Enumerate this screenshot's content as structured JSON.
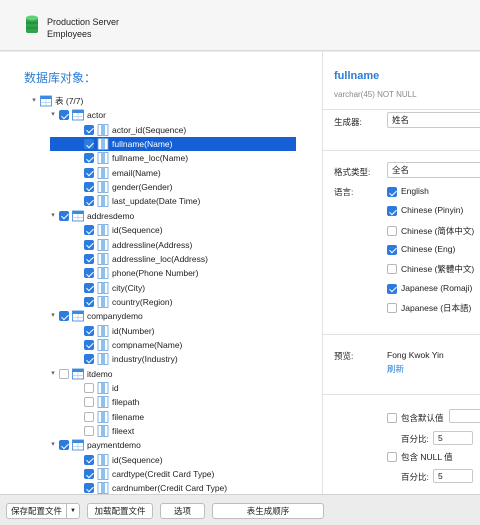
{
  "window": {
    "title": "Production Server",
    "subtitle": "Employees"
  },
  "left": {
    "title": "数据库对象：",
    "tree": [
      {
        "level": 0,
        "disc": "down",
        "cb": false,
        "icon": "tables",
        "label": "表 (7/7)"
      },
      {
        "level": 1,
        "disc": "down",
        "cb": true,
        "icon": "table",
        "label": "actor"
      },
      {
        "level": 2,
        "cb": true,
        "icon": "column",
        "label": "actor_id(Sequence)"
      },
      {
        "level": 2,
        "cb": true,
        "icon": "column",
        "label": "fullname(Name)",
        "selected": true
      },
      {
        "level": 2,
        "cb": true,
        "icon": "column",
        "label": "fullname_loc(Name)"
      },
      {
        "level": 2,
        "cb": true,
        "icon": "column",
        "label": "email(Name)"
      },
      {
        "level": 2,
        "cb": true,
        "icon": "column",
        "label": "gender(Gender)"
      },
      {
        "level": 2,
        "cb": true,
        "icon": "column",
        "label": "last_update(Date Time)"
      },
      {
        "level": 1,
        "disc": "down",
        "cb": true,
        "icon": "table",
        "label": "addresdemo"
      },
      {
        "level": 2,
        "cb": true,
        "icon": "column",
        "label": "id(Sequence)"
      },
      {
        "level": 2,
        "cb": true,
        "icon": "column",
        "label": "addressline(Address)"
      },
      {
        "level": 2,
        "cb": true,
        "icon": "column",
        "label": "addressline_loc(Address)"
      },
      {
        "level": 2,
        "cb": true,
        "icon": "column",
        "label": "phone(Phone Number)"
      },
      {
        "level": 2,
        "cb": true,
        "icon": "column",
        "label": "city(City)"
      },
      {
        "level": 2,
        "cb": true,
        "icon": "column",
        "label": "country(Region)"
      },
      {
        "level": 1,
        "disc": "down",
        "cb": true,
        "icon": "table",
        "label": "companydemo"
      },
      {
        "level": 2,
        "cb": true,
        "icon": "column",
        "label": "id(Number)"
      },
      {
        "level": 2,
        "cb": true,
        "icon": "column",
        "label": "compname(Name)"
      },
      {
        "level": 2,
        "cb": true,
        "icon": "column",
        "label": "industry(Industry)"
      },
      {
        "level": 1,
        "disc": "down",
        "cb": false,
        "icon": "table",
        "label": "itdemo"
      },
      {
        "level": 2,
        "cb": false,
        "icon": "column",
        "label": "id"
      },
      {
        "level": 2,
        "cb": false,
        "icon": "column",
        "label": "filepath"
      },
      {
        "level": 2,
        "cb": false,
        "icon": "column",
        "label": "filename"
      },
      {
        "level": 2,
        "cb": false,
        "icon": "column",
        "label": "fileext"
      },
      {
        "level": 1,
        "disc": "down",
        "cb": true,
        "icon": "table",
        "label": "paymentdemo"
      },
      {
        "level": 2,
        "cb": true,
        "icon": "column",
        "label": "id(Sequence)"
      },
      {
        "level": 2,
        "cb": true,
        "icon": "column",
        "label": "cardtype(Credit Card Type)"
      },
      {
        "level": 2,
        "cb": true,
        "icon": "column",
        "label": "cardnumber(Credit Card Type)"
      }
    ]
  },
  "right": {
    "field_name": "fullname",
    "field_type": "varchar(45) NOT NULL",
    "generator_label": "生成器:",
    "generator_value": "姓名",
    "format_label": "格式类型:",
    "format_value": "全名",
    "language_label": "语言:",
    "languages": [
      {
        "label": "English",
        "checked": true
      },
      {
        "label": "Chinese (Pinyin)",
        "checked": true
      },
      {
        "label": "Chinese (简体中文)",
        "checked": false
      },
      {
        "label": "Chinese (Eng)",
        "checked": true
      },
      {
        "label": "Chinese (繁體中文)",
        "checked": false
      },
      {
        "label": "Japanese (Romaji)",
        "checked": true
      },
      {
        "label": "Japanese (日本語)",
        "checked": false
      }
    ],
    "preview_label": "预览:",
    "preview_value": "Fong Kwok Yin",
    "refresh_label": "刷新",
    "include_default_label": "包含默认值",
    "percent_label": "百分比:",
    "percent_default": "5",
    "include_null_label": "包含 NULL 值",
    "percent_null": "5"
  },
  "bottom": {
    "save_config": "保存配置文件",
    "load_config": "加载配置文件",
    "options": "选项",
    "table_order": "表生成顺序"
  },
  "colors": {
    "accent": "#2a7fd4",
    "selection": "#1560d4",
    "checkbox": "#2c7ce0"
  }
}
